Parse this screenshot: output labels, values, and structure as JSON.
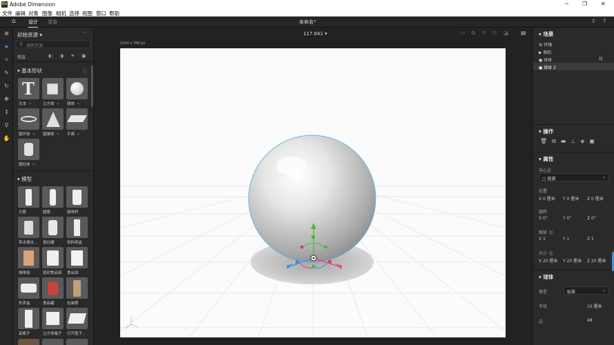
{
  "window": {
    "app_badge": "Dn",
    "title": "Adobe Dimension",
    "min": "─",
    "max": "❐",
    "close": "✕"
  },
  "menu": [
    "文件",
    "编辑",
    "对象",
    "图像",
    "相机",
    "选择",
    "视图",
    "窗口",
    "帮助"
  ],
  "topbar": {
    "tab_design": "设计",
    "tab_render": "渲染",
    "doc_title": "未命名*",
    "zoom": "117.841 ▾"
  },
  "assets": {
    "title": "初始资源 ▾",
    "search_placeholder": "搜索资源",
    "filter_label": "筛选",
    "basic_section": "基本形状",
    "model_section": "模型",
    "basic": [
      {
        "label": "文本"
      },
      {
        "label": "立方体"
      },
      {
        "label": "球体"
      },
      {
        "label": "圆环体"
      },
      {
        "label": "圆锥体"
      },
      {
        "label": "平面"
      },
      {
        "label": "圆柱体"
      }
    ],
    "models": [
      {
        "label": "方瓶"
      },
      {
        "label": "圆瓶"
      },
      {
        "label": "咖啡杯"
      },
      {
        "label": "带冰凝水..."
      },
      {
        "label": "易拉罐"
      },
      {
        "label": "饮料纸盒"
      },
      {
        "label": "咖啡袋"
      },
      {
        "label": "密封食品袋"
      },
      {
        "label": "食品袋"
      },
      {
        "label": "外卖盒"
      },
      {
        "label": "食品罐"
      },
      {
        "label": "包装筒"
      },
      {
        "label": "高瓶子"
      },
      {
        "label": "立方体箱子"
      },
      {
        "label": "打开盖子..."
      }
    ],
    "swatch": "≈"
  },
  "canvas": {
    "size_label": "1024 x 768 px"
  },
  "scene": {
    "title": "场景",
    "items": [
      {
        "label": "环境"
      },
      {
        "label": "相机"
      },
      {
        "label": "球体"
      },
      {
        "label": "球体 2"
      }
    ]
  },
  "actions": {
    "title": "操作"
  },
  "props": {
    "title": "属性",
    "center_label": "中心点",
    "center_value": "底部",
    "pos_label": "位置",
    "pos": [
      "X 0 厘米",
      "Y 0 厘米",
      "Z 0 厘米"
    ],
    "rot_label": "旋转",
    "rot": [
      "X 0°",
      "Y 0°",
      "Z 0°"
    ],
    "scale_label": "缩放",
    "scale": [
      "X 1",
      "Y 1",
      "Z 1"
    ],
    "size_label": "大小",
    "size": [
      "X 20 厘米",
      "Y 20 厘米",
      "Z 20 厘米"
    ]
  },
  "sphere": {
    "title": "球体",
    "type_label": "类型",
    "type_value": "标准",
    "radius_label": "半径",
    "radius_value": "10 厘米",
    "sides_label": "边",
    "sides_value": "48"
  }
}
